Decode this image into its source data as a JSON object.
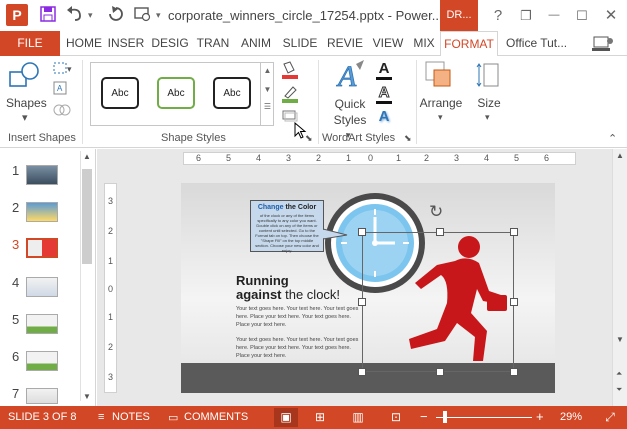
{
  "titlebar": {
    "app_icon": "P",
    "save_icon": "save-icon",
    "undo_icon": "undo-icon",
    "redo_icon": "redo-icon",
    "title": "corporate_winners_circle_17254.pptx - Power...",
    "context_tab": "DR...",
    "help": "?",
    "restore": "❐",
    "minimize": "—",
    "maximize": "☐",
    "close": "✕"
  },
  "tabs": {
    "file": "FILE",
    "items": [
      "HOME",
      "INSER",
      "DESIG",
      "TRAN",
      "ANIM",
      "SLIDE",
      "REVIE",
      "VIEW",
      "MIX"
    ],
    "format": "FORMAT",
    "office": "Office Tut..."
  },
  "ribbon": {
    "shapes_label": "Shapes",
    "insert_shapes_label": "Insert Shapes",
    "style_samples": [
      "Abc",
      "Abc",
      "Abc"
    ],
    "style_colors": [
      "#222222",
      "#70ad47",
      "#222222"
    ],
    "shape_styles_label": "Shape Styles",
    "quick_styles_label": "Quick Styles",
    "quick_label_line1": "Quick",
    "quick_label_line2": "Styles",
    "wordart_label": "WordArt Styles",
    "text_glyph": "A",
    "arrange_label": "Arrange",
    "size_label": "Size"
  },
  "thumbnails": {
    "numbers": [
      "1",
      "2",
      "3",
      "4",
      "5",
      "6",
      "7"
    ],
    "active_index": 3
  },
  "ruler": {
    "h_ticks": [
      "6",
      "5",
      "4",
      "3",
      "2",
      "1",
      "0",
      "1",
      "2",
      "3",
      "4",
      "5",
      "6"
    ],
    "v_ticks": [
      "3",
      "2",
      "1",
      "0",
      "1",
      "2",
      "3"
    ]
  },
  "slide": {
    "callout_title_colored": "Change",
    "callout_title_rest": " the Color",
    "callout_body": "of the clock or any of the items specifically to any color you want. Double click on any of the items or content until selected. Go to the Format tab on top. Then choose the \"Shape Fill\" on the top middle section. Choose your new color and enjoy.",
    "heading_line1": "Running",
    "heading_line2_bold": "against",
    "heading_line2_rest": " the clock!",
    "body_para1": "Your text goes here. Your text here. Your text goes here. Place your text here. Your text goes here. Place your text here.",
    "body_para2": "Your text goes here. Your text here. Your text goes here. Place your text here. Your text goes here. Place your text here.",
    "colors": {
      "runner": "#c8171a",
      "clock_face": "#7cc5ee",
      "clock_ring": "#4a4a4a"
    }
  },
  "status": {
    "slide_of": "SLIDE 3 OF 8",
    "notes": "NOTES",
    "comments": "COMMENTS",
    "zoom_minus": "−",
    "zoom_plus": "+",
    "zoom": "29%"
  }
}
